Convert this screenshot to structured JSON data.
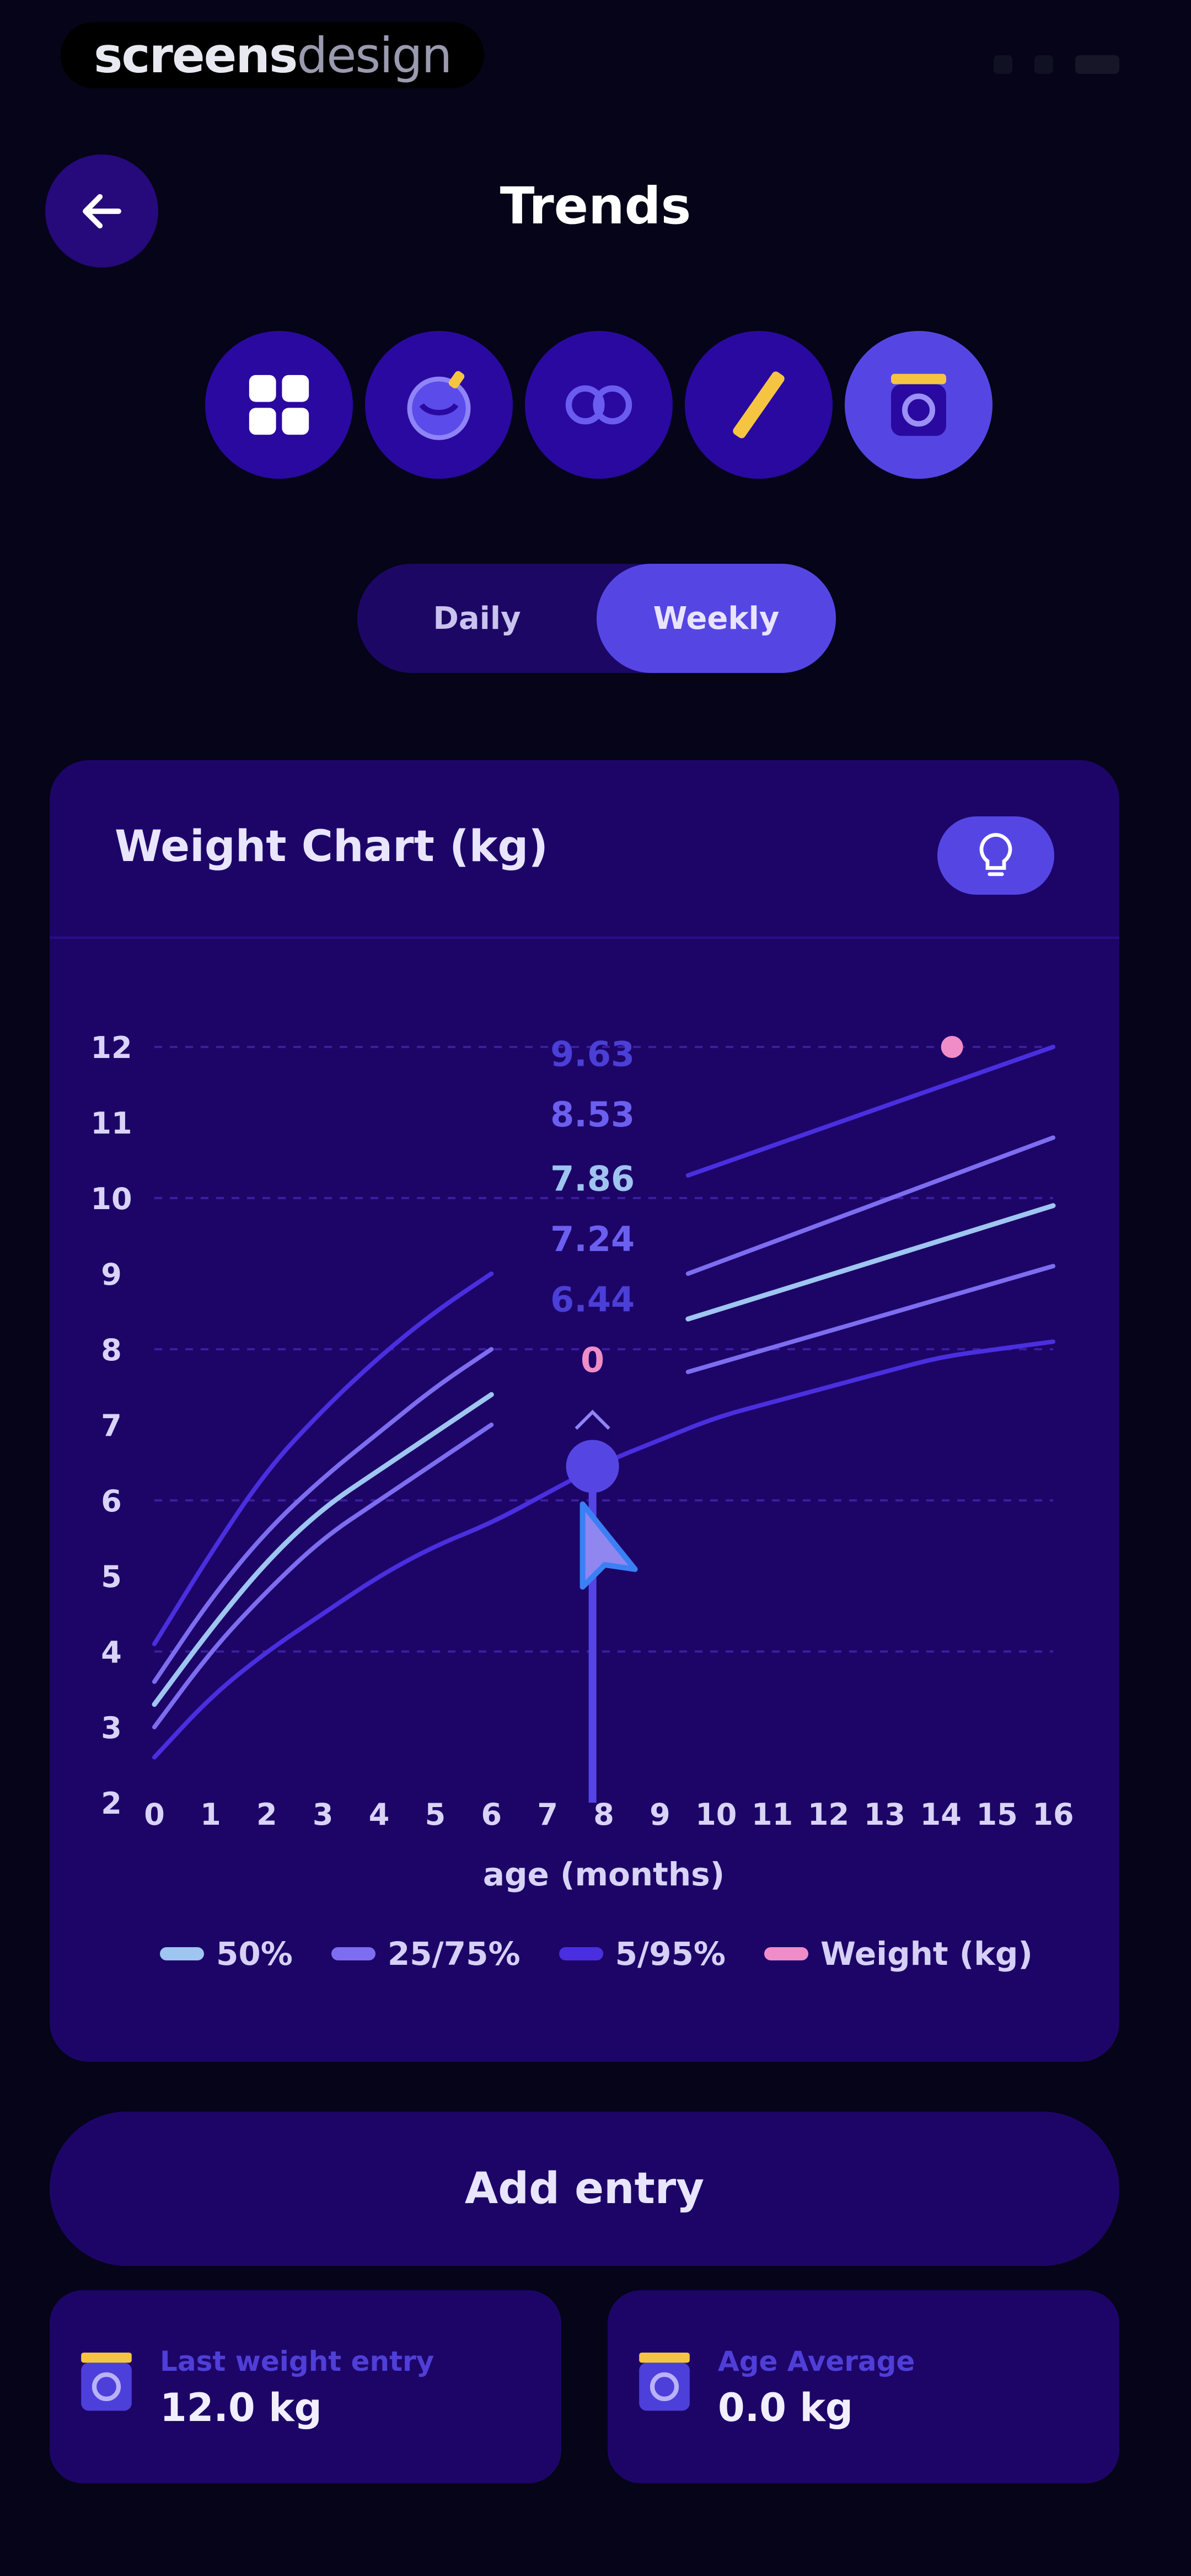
{
  "watermark": {
    "bold": "screens",
    "light": "design"
  },
  "header": {
    "title": "Trends"
  },
  "categories": [
    {
      "name": "all",
      "icon": "grid-icon",
      "active": false
    },
    {
      "name": "feeding",
      "icon": "bottle-icon",
      "active": false
    },
    {
      "name": "diaper",
      "icon": "diaper-icon",
      "active": false
    },
    {
      "name": "growth",
      "icon": "ruler-icon",
      "active": false
    },
    {
      "name": "weight",
      "icon": "scale-icon",
      "active": true
    }
  ],
  "toggle": {
    "daily_label": "Daily",
    "weekly_label": "Weekly",
    "selected": "weekly"
  },
  "colors": {
    "background": "#050418",
    "card": "#1d0568",
    "accent": "#5546e4",
    "p50": "#9ec6f0",
    "p25_75": "#7d6df0",
    "p5_95": "#4a2fe0",
    "weight": "#f08cc8"
  },
  "chart": {
    "title": "Weight Chart (kg)",
    "xlabel": "age (months)",
    "tooltip": {
      "p95": "9.63",
      "p75": "8.53",
      "p50": "7.86",
      "p25": "7.24",
      "p5": "6.44",
      "weight": "0"
    },
    "legend": [
      {
        "label": "50%",
        "color": "#9ec6f0"
      },
      {
        "label": "25/75%",
        "color": "#7d6df0"
      },
      {
        "label": "5/95%",
        "color": "#4a2fe0"
      },
      {
        "label": "Weight (kg)",
        "color": "#f08cc8"
      }
    ]
  },
  "chart_data": {
    "type": "line",
    "title": "Weight Chart (kg)",
    "xlabel": "age (months)",
    "ylabel": "",
    "xlim": [
      0,
      16
    ],
    "ylim": [
      2,
      12
    ],
    "x_ticks": [
      "0",
      "1",
      "2",
      "3",
      "4",
      "5",
      "6",
      "7",
      "8",
      "9",
      "10",
      "11",
      "12",
      "13",
      "14",
      "15",
      "16"
    ],
    "y_ticks": [
      "2",
      "3",
      "4",
      "5",
      "6",
      "7",
      "8",
      "9",
      "10",
      "11",
      "12"
    ],
    "grid": true,
    "legend_position": "bottom",
    "cursor_x": 7.8,
    "series": [
      {
        "name": "5/95%",
        "x": [
          0,
          1,
          2,
          3,
          4,
          5,
          6,
          9.5,
          16
        ],
        "y": [
          4.1,
          5.3,
          6.4,
          7.2,
          7.9,
          8.5,
          9.0,
          10.3,
          12.0
        ]
      },
      {
        "name": "25/75%",
        "x": [
          0,
          1,
          2,
          3,
          4,
          5,
          6,
          9.5,
          16
        ],
        "y": [
          3.6,
          4.7,
          5.6,
          6.3,
          6.9,
          7.5,
          8.0,
          9.0,
          10.8
        ]
      },
      {
        "name": "50%",
        "x": [
          0,
          1,
          2,
          3,
          4,
          5,
          6,
          9.5,
          16
        ],
        "y": [
          3.3,
          4.3,
          5.2,
          5.9,
          6.4,
          6.9,
          7.4,
          8.4,
          9.9
        ]
      },
      {
        "name": "25/75%",
        "x": [
          0,
          1,
          2,
          3,
          4,
          5,
          6,
          9.5,
          16
        ],
        "y": [
          3.0,
          4.0,
          4.8,
          5.5,
          6.0,
          6.5,
          7.0,
          7.7,
          9.1
        ]
      },
      {
        "name": "5/95%",
        "x": [
          0,
          1,
          2,
          3,
          4,
          5,
          6,
          7,
          8,
          9,
          10,
          11,
          12,
          13,
          14,
          15,
          16
        ],
        "y": [
          2.6,
          3.4,
          4.0,
          4.5,
          5.0,
          5.4,
          5.7,
          6.1,
          6.5,
          6.8,
          7.1,
          7.3,
          7.5,
          7.7,
          7.9,
          8.0,
          8.1
        ]
      },
      {
        "name": "Weight (kg)",
        "x": [
          14.2
        ],
        "y": [
          12.0
        ]
      }
    ]
  },
  "add_entry": {
    "label": "Add entry"
  },
  "stats": [
    {
      "label": "Last weight entry",
      "value": "12.0 kg"
    },
    {
      "label": "Age Average",
      "value": "0.0 kg"
    }
  ]
}
